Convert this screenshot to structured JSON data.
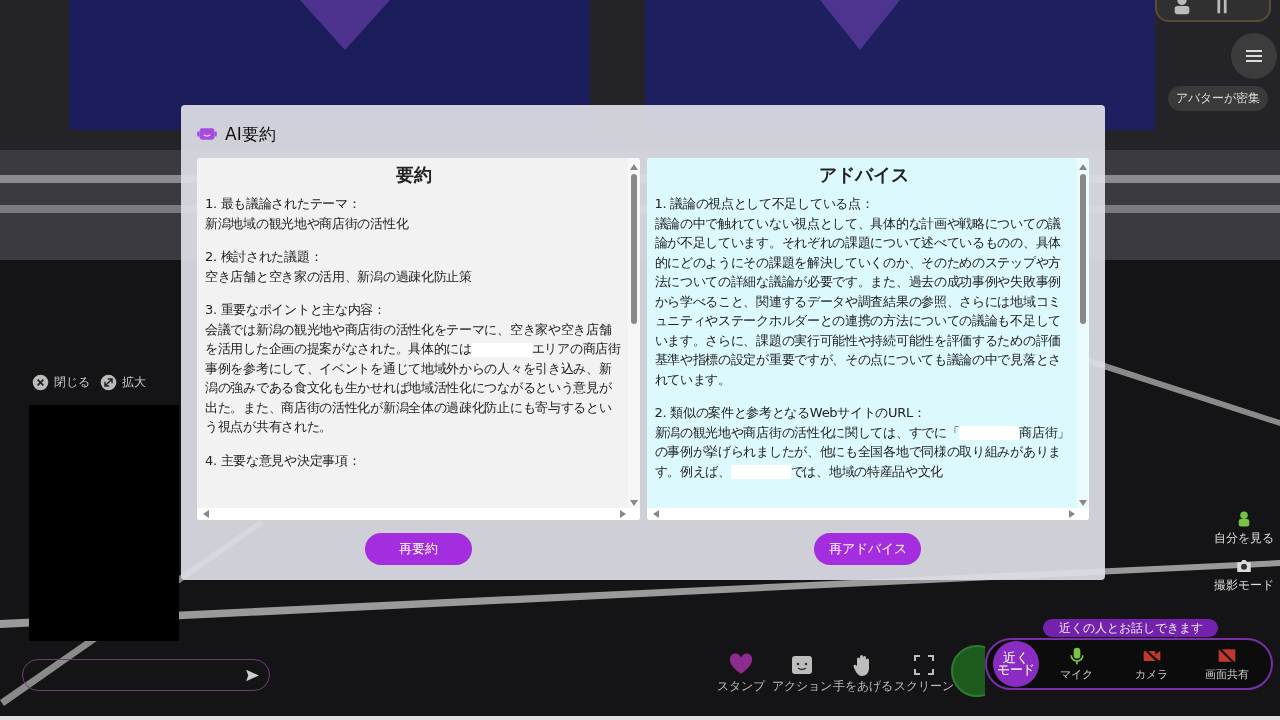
{
  "crowd_notice": "アバターが密集",
  "video_panel": {
    "close_label": "閉じる",
    "expand_label": "拡大"
  },
  "side_buttons": [
    {
      "kind": "self_view",
      "label": "自分を見る"
    },
    {
      "label": "撮影モード"
    }
  ],
  "modal": {
    "title": "AI要約",
    "panels": [
      {
        "heading": "要約",
        "color": "#f2f2f2",
        "button": "再要約",
        "sections": [
          {
            "title": "1. 最も議論されたテーマ：",
            "body": [
              {
                "kind": "text",
                "text": "新潟地域の観光地や商店街の活性化"
              }
            ]
          },
          {
            "title": "2. 検討された議題：",
            "body": [
              {
                "kind": "text",
                "text": "空き店舗と空き家の活用、新潟の過疎化防止策"
              }
            ]
          },
          {
            "title": "3. 重要なポイントと主な内容：",
            "body": [
              {
                "kind": "text",
                "text": "会議では新潟の観光地や商店街の活性化をテーマに、空き家や空き店舗を活用した企画の提案がなされた。具体的には"
              },
              {
                "kind": "redacted"
              },
              {
                "kind": "text",
                "text": "エリアの商店街事例を参考にして、イベントを通じて地域外からの人々を引き込み、新潟の強みである食文化も生かせれば地域活性化につながるという意見が出た。また、商店街の活性化が新潟全体の過疎化防止にも寄与するという視点が共有された。"
              }
            ]
          },
          {
            "title": "4. 主要な意見や決定事項："
          }
        ]
      },
      {
        "heading": "アドバイス",
        "color": "#dcfafd",
        "button": "再アドバイス",
        "sections": [
          {
            "title": "1. 議論の視点として不足している点：",
            "body": [
              {
                "kind": "text",
                "text": "議論の中で触れていない視点として、具体的な計画や戦略についての議論が不足しています。それぞれの課題について述べているものの、具体的にどのようにその課題を解決していくのか、そのためのステップや方法についての詳細な議論が必要です。また、過去の成功事例や失敗事例から学べること、関連するデータや調査結果の参照、さらには地域コミュニティやステークホルダーとの連携の方法についての議論も不足しています。さらに、課題の実行可能性や持続可能性を評価するための評価基準や指標の設定が重要ですが、その点についても議論の中で見落とされています。"
              }
            ]
          },
          {
            "title": "2. 類似の案件と参考となるWebサイトのURL：",
            "body": [
              {
                "kind": "text",
                "text": "新潟の観光地や商店街の活性化に関しては、すでに「"
              },
              {
                "kind": "redacted"
              },
              {
                "kind": "text",
                "text": "商店街」の事例が挙げられましたが、他にも全国各地で同様の取り組みがあります。例えば、"
              },
              {
                "kind": "redacted"
              },
              {
                "kind": "text",
                "text": "では、地域の特産品や文化"
              }
            ]
          }
        ]
      }
    ]
  },
  "toolbar": [
    {
      "kind": "heart",
      "label": "スタンプ"
    },
    {
      "kind": "face",
      "label": "アクション"
    },
    {
      "kind": "hand",
      "label": "手をあげる"
    },
    {
      "kind": "frame",
      "label": "スクリーン"
    }
  ],
  "voice": {
    "hint": "近くの人とお話しできます",
    "mode_main": "近く",
    "mode_sub": "モード",
    "devices": [
      {
        "kind": "mic",
        "label": "マイク",
        "on": true
      },
      {
        "kind": "camera",
        "label": "カメラ",
        "on": false
      },
      {
        "kind": "screen",
        "label": "画面共有",
        "on": false
      }
    ]
  }
}
